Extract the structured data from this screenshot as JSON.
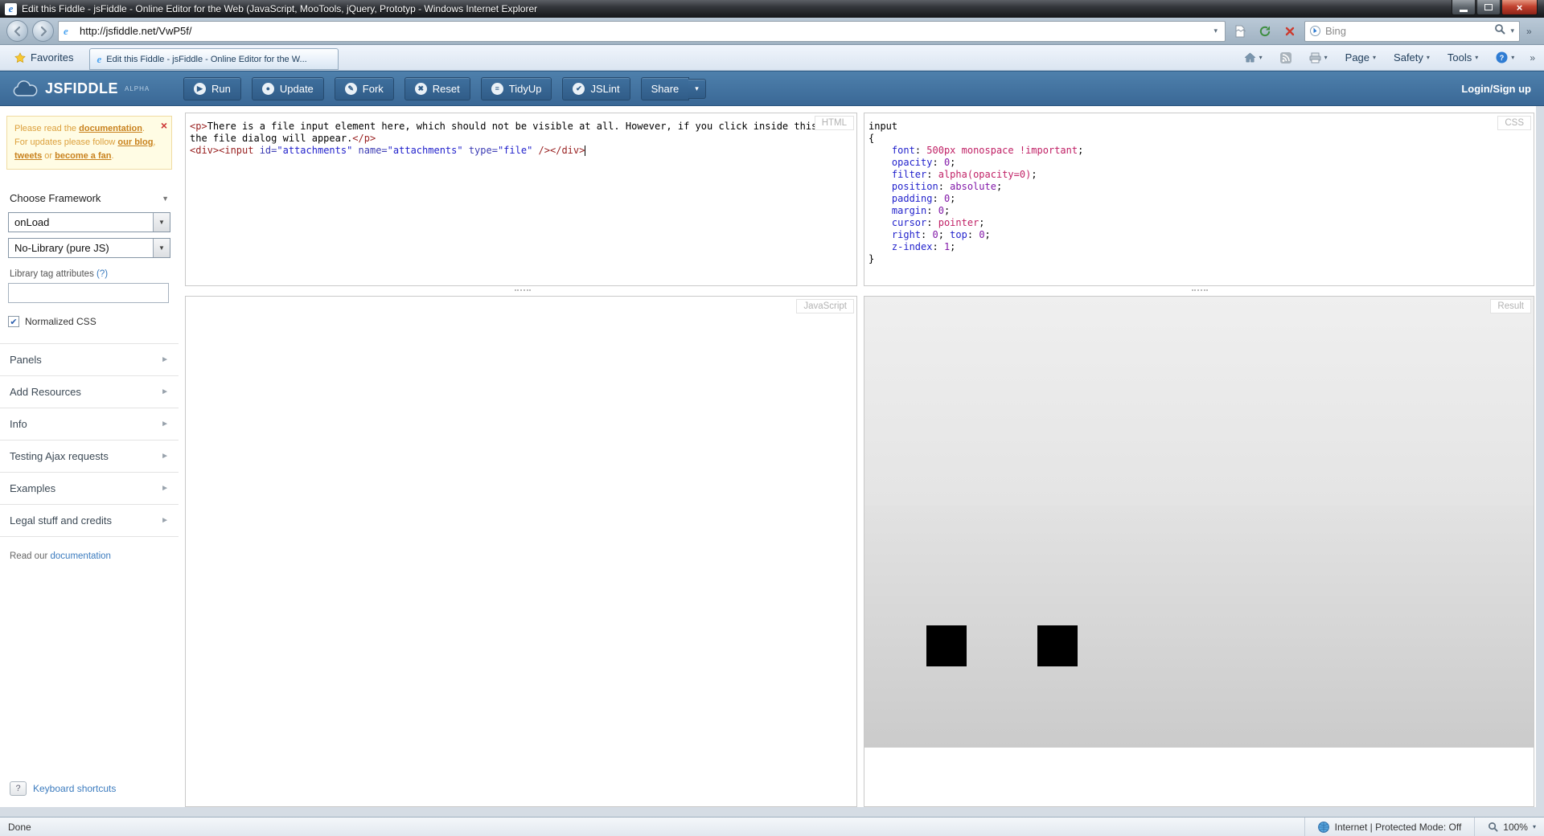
{
  "icons": {
    "dropdown": "▾",
    "select_arrow": "▼",
    "collapse": "▼",
    "expand": "►",
    "overflow": "»",
    "close": "×",
    "check": "✔",
    "ie_e": "e"
  },
  "window": {
    "title": "Edit this Fiddle - jsFiddle - Online Editor for the Web (JavaScript, MooTools, jQuery, Prototyp - Windows Internet Explorer"
  },
  "address_bar": {
    "url": "http://jsfiddle.net/VwP5f/",
    "search_placeholder": "Bing"
  },
  "favorites_bar": {
    "favorites_label": "Favorites",
    "tab_title": "Edit this Fiddle - jsFiddle - Online Editor for the W...",
    "page_menu": "Page",
    "safety_menu": "Safety",
    "tools_menu": "Tools"
  },
  "app_header": {
    "logo_text": "JSFIDDLE",
    "logo_badge": "ALPHA",
    "buttons": [
      {
        "name": "run",
        "label": "Run",
        "glyph": "▶"
      },
      {
        "name": "update",
        "label": "Update",
        "glyph": "●"
      },
      {
        "name": "fork",
        "label": "Fork",
        "glyph": "✎"
      },
      {
        "name": "reset",
        "label": "Reset",
        "glyph": "✖"
      },
      {
        "name": "tidyup",
        "label": "TidyUp",
        "glyph": "≡"
      },
      {
        "name": "jslint",
        "label": "JSLint",
        "glyph": "✔"
      },
      {
        "name": "share",
        "label": "Share",
        "glyph": "",
        "dropdown": true
      }
    ],
    "login_label": "Login/Sign up"
  },
  "sidebar": {
    "notice_lines": [
      [
        [
          "nt",
          "Please read the "
        ],
        [
          "nl",
          "documentation"
        ],
        [
          "nt",
          "."
        ]
      ],
      [
        [
          "nt",
          "For updates please follow "
        ],
        [
          "nl",
          "our blog"
        ],
        [
          "nt",
          ", "
        ],
        [
          "nl",
          "tweets"
        ],
        [
          "nt",
          " or "
        ],
        [
          "nl",
          "become a fan"
        ],
        [
          "nt",
          "."
        ]
      ]
    ],
    "choose_framework_label": "Choose Framework",
    "onload_select": "onLoad",
    "library_select": "No-Library (pure JS)",
    "library_attr_label": "Library tag attributes",
    "library_attr_help": "(?)",
    "normalized_css_label": "Normalized CSS",
    "sections": [
      "Panels",
      "Add Resources",
      "Info",
      "Testing Ajax requests",
      "Examples",
      "Legal stuff and credits"
    ],
    "read_our": "Read our",
    "doc_link": "documentation",
    "shortcuts_btn": "?",
    "shortcuts_label": "Keyboard shortcuts"
  },
  "panels": {
    "html": {
      "label": "HTML",
      "lines": [
        [
          [
            "tag",
            "<p>"
          ],
          [
            "text",
            "There is a file input element here, which should not be visible at all. However, if you click inside this area"
          ]
        ],
        [
          [
            "text",
            "the file dialog will appear."
          ],
          [
            "tag",
            "</p>"
          ]
        ],
        [
          [
            "tag",
            "<div>"
          ],
          [
            "tag",
            "<input"
          ],
          [
            "attr",
            " id="
          ],
          [
            "str",
            "\"attachments\""
          ],
          [
            "attr",
            " name="
          ],
          [
            "str",
            "\"attachments\""
          ],
          [
            "attr",
            " type="
          ],
          [
            "str",
            "\"file\""
          ],
          [
            "tag",
            " />"
          ],
          [
            "tag",
            "</div>"
          ],
          [
            "cursor",
            ""
          ]
        ]
      ]
    },
    "css": {
      "label": "CSS",
      "lines": [
        [
          [
            "plain",
            "input"
          ]
        ],
        [
          [
            "plain",
            "{"
          ]
        ],
        [
          [
            "plain",
            "    "
          ],
          [
            "prop",
            "font"
          ],
          [
            "plain",
            ": "
          ],
          [
            "val",
            "500px monospace !important"
          ],
          [
            "plain",
            ";"
          ]
        ],
        [
          [
            "plain",
            "    "
          ],
          [
            "prop",
            "opacity"
          ],
          [
            "plain",
            ": "
          ],
          [
            "num",
            "0"
          ],
          [
            "plain",
            ";"
          ]
        ],
        [
          [
            "plain",
            "    "
          ],
          [
            "prop",
            "filter"
          ],
          [
            "plain",
            ": "
          ],
          [
            "val",
            "alpha(opacity=0)"
          ],
          [
            "plain",
            ";"
          ]
        ],
        [
          [
            "plain",
            "    "
          ],
          [
            "prop",
            "position"
          ],
          [
            "plain",
            ": "
          ],
          [
            "kw",
            "absolute"
          ],
          [
            "plain",
            ";"
          ]
        ],
        [
          [
            "plain",
            "    "
          ],
          [
            "prop",
            "padding"
          ],
          [
            "plain",
            ": "
          ],
          [
            "num",
            "0"
          ],
          [
            "plain",
            ";"
          ]
        ],
        [
          [
            "plain",
            "    "
          ],
          [
            "prop",
            "margin"
          ],
          [
            "plain",
            ": "
          ],
          [
            "num",
            "0"
          ],
          [
            "plain",
            ";"
          ]
        ],
        [
          [
            "plain",
            "    "
          ],
          [
            "prop",
            "cursor"
          ],
          [
            "plain",
            ": "
          ],
          [
            "val",
            "pointer"
          ],
          [
            "plain",
            ";"
          ]
        ],
        [
          [
            "plain",
            "    "
          ],
          [
            "prop",
            "right"
          ],
          [
            "plain",
            ": "
          ],
          [
            "num",
            "0"
          ],
          [
            "plain",
            "; "
          ],
          [
            "prop",
            "top"
          ],
          [
            "plain",
            ": "
          ],
          [
            "num",
            "0"
          ],
          [
            "plain",
            ";"
          ]
        ],
        [
          [
            "plain",
            "    "
          ],
          [
            "prop",
            "z-index"
          ],
          [
            "plain",
            ": "
          ],
          [
            "num",
            "1"
          ],
          [
            "plain",
            ";"
          ]
        ],
        [
          [
            "plain",
            "}"
          ]
        ]
      ]
    },
    "javascript": {
      "label": "JavaScript"
    },
    "result": {
      "label": "Result"
    }
  },
  "status_bar": {
    "status": "Done",
    "zone": "Internet | Protected Mode: Off",
    "zoom": "100%"
  },
  "colors": {
    "header_blue": "#43739f",
    "toolbar_button_blue": "#35638f",
    "notice_bg": "#fffce4",
    "notice_text": "#dca03c",
    "link_blue": "#3b7bbe",
    "close_red": "#c2422f",
    "syntax": {
      "tag": "#992222",
      "attribute": "#3c3cb4",
      "string": "#2222cc",
      "css_property": "#2222cc",
      "css_value": "#c02065",
      "css_number": "#8218a8"
    }
  }
}
